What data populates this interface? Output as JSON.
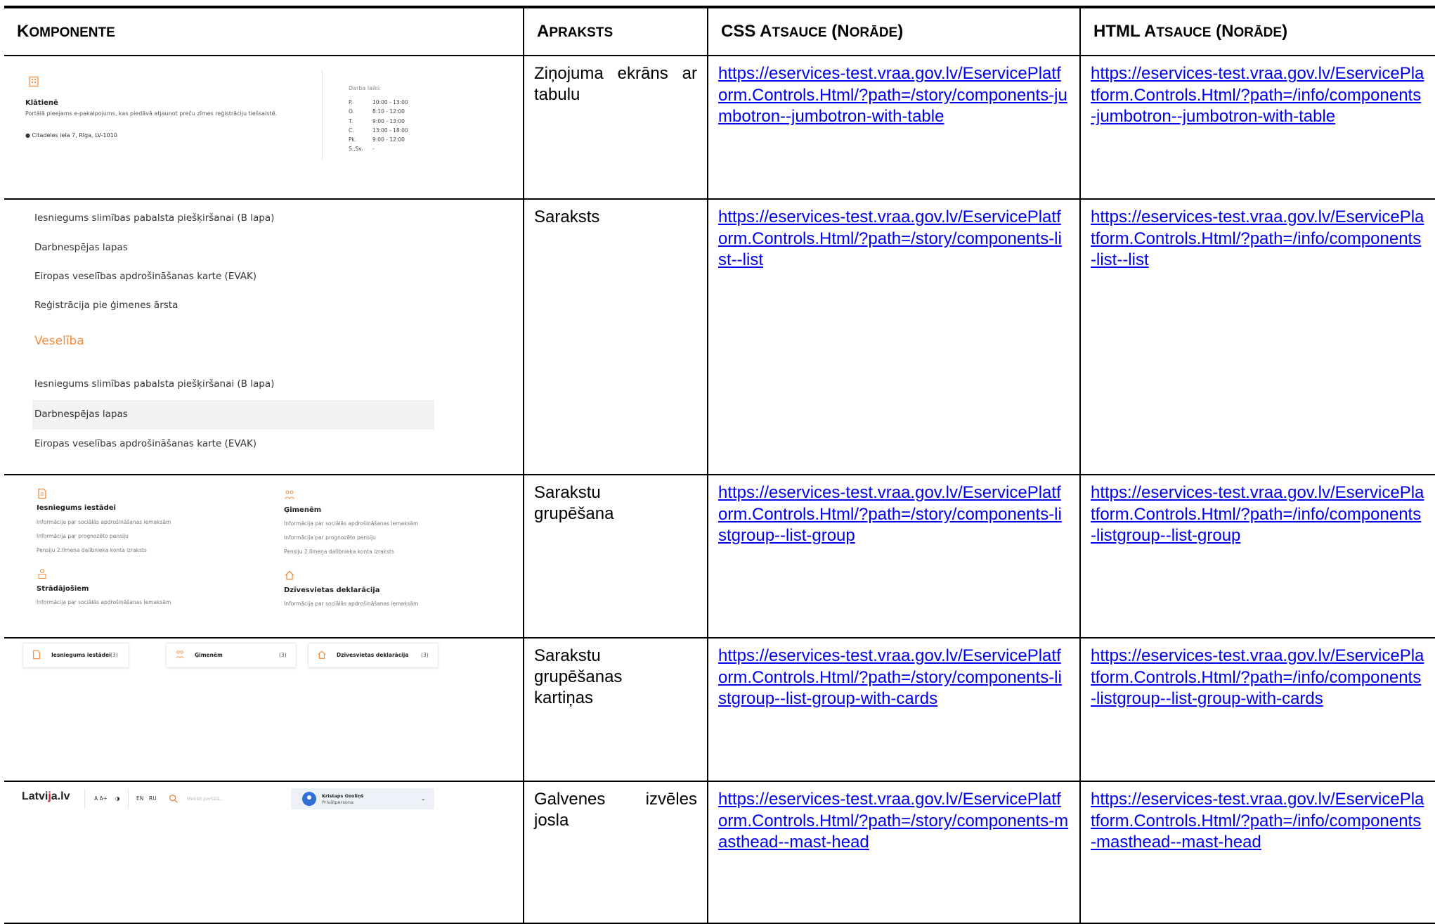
{
  "header": {
    "col1": {
      "big": "K",
      "sc": "OMPONENTE"
    },
    "col2": {
      "big": "A",
      "sc": "PRAKSTS"
    },
    "col3": {
      "big1": "CSS A",
      "sc1": "TSAUCE",
      "big2": " (N",
      "sc2": "ORĀDE",
      "big3": ")"
    },
    "col4": {
      "big1": "HTML A",
      "sc1": "TSAUCE",
      "big2": " (N",
      "sc2": "ORĀDE",
      "big3": ")"
    }
  },
  "rows": [
    {
      "desc": [
        "Ziņojuma ekrāns ar",
        "tabulu"
      ],
      "css": "https://eservices-test.vraa.gov.lv/EservicePlatform.Controls.Html/?path=/story/components-jumbotron--jumbotron-with-table",
      "html": "https://eservices-test.vraa.gov.lv/EservicePlatform.Controls.Html/?path=/info/components-jumbotron--jumbotron-with-table"
    },
    {
      "desc": [
        "Saraksts"
      ],
      "css": "https://eservices-test.vraa.gov.lv/EservicePlatform.Controls.Html/?path=/story/components-list--list",
      "html": "https://eservices-test.vraa.gov.lv/EservicePlatform.Controls.Html/?path=/info/components-list--list"
    },
    {
      "desc": [
        "Sarakstu",
        "grupēšana"
      ],
      "css": "https://eservices-test.vraa.gov.lv/EservicePlatform.Controls.Html/?path=/story/components-listgroup--list-group",
      "html": "https://eservices-test.vraa.gov.lv/EservicePlatform.Controls.Html/?path=/info/components-listgroup--list-group"
    },
    {
      "desc": [
        "Sarakstu",
        "grupēšanas",
        "kartiņas"
      ],
      "css": "https://eservices-test.vraa.gov.lv/EservicePlatform.Controls.Html/?path=/story/components-listgroup--list-group-with-cards",
      "html": "https://eservices-test.vraa.gov.lv/EservicePlatform.Controls.Html/?path=/info/components-listgroup--list-group-with-cards"
    },
    {
      "desc": [
        "Galvenes izvēles",
        "josla"
      ],
      "css": "https://eservices-test.vraa.gov.lv/EservicePlatform.Controls.Html/?path=/story/components-masthead--mast-head",
      "html": "https://eservices-test.vraa.gov.lv/EservicePlatform.Controls.Html/?path=/info/components-masthead--mast-head"
    }
  ],
  "jumbotron": {
    "title": "Klātienē",
    "subtitle": "Portālā pieejams e-pakalpojums, kas piedāvā atjaunot preču zīmes reģistrāciju tiešsaistē.",
    "address": "Citadeles iela 7, Rīga, LV-1010",
    "hours_label": "Darba laiki:",
    "days": [
      "P.",
      "O.",
      "T.",
      "C.",
      "Pk.",
      "S.,Sv."
    ],
    "hours": [
      "10:00 - 13:00",
      "8:10 - 12:00",
      "9:00 - 13:00",
      "13:00 - 18:00",
      "9:00 - 12:00",
      "-"
    ]
  },
  "list": {
    "items_top": [
      "Iesniegums slimības pabalsta piešķiršanai (B lapa)",
      "Darbnespējas lapas",
      "Eiropas veselības apdrošināšanas karte (EVAK)",
      "Reģistrācija pie ģimenes ārsta"
    ],
    "group_title": "Veselība",
    "items_bottom": [
      "Iesniegums slimības pabalsta piešķiršanai (B lapa)",
      "Darbnespējas lapas",
      "Eiropas veselības apdrošināšanas karte (EVAK)"
    ]
  },
  "listgroup": {
    "g1": {
      "title": "Iesniegums iestādei",
      "items": [
        "Informācija par sociālās apdrošināšanas iemaksām",
        "Informācija par prognozēto pensiju",
        "Pensiju 2.līmeņa dalībnieka konta izraksts"
      ]
    },
    "g2": {
      "title": "Ģimenēm",
      "items": [
        "Informācija par sociālās apdrošināšanas iemaksām",
        "Informācija par prognozēto pensiju",
        "Pensiju 2.līmeņa dalībnieka konta izraksts"
      ]
    },
    "g3": {
      "title": "Strādājošiem",
      "items": [
        "Informācija par sociālās apdrošināšanas iemaksām"
      ]
    },
    "g4": {
      "title": "Dzīvesvietas deklarācija",
      "items": [
        "Informācija par sociālās apdrošināšanas iemaksām"
      ]
    }
  },
  "cards": [
    {
      "label": "Iesniegums iestādei",
      "count": "(3)"
    },
    {
      "label": "Ģimenēm",
      "count": "(3)"
    },
    {
      "label": "Dzīvesvietas deklarācija",
      "count": "(3)"
    }
  ],
  "masthead": {
    "logo_a": "Latvi",
    "logo_j": "j",
    "logo_b": "a.lv",
    "font_size": "A A+",
    "lang_en": "EN",
    "lang_ru": "RU",
    "search_placeholder": "Meklēt portālā...",
    "user_name": "Kristaps Ozoliņš",
    "user_role": "Privātpersona"
  }
}
